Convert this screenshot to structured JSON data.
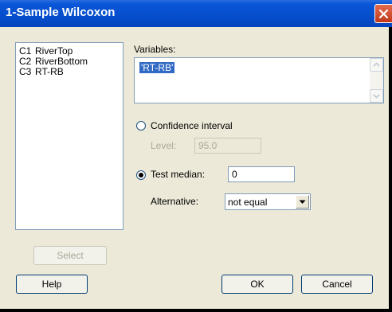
{
  "window": {
    "title": "1-Sample Wilcoxon"
  },
  "columns": [
    {
      "id": "C1",
      "name": "RiverTop"
    },
    {
      "id": "C2",
      "name": "RiverBottom"
    },
    {
      "id": "C3",
      "name": "RT-RB"
    }
  ],
  "variables": {
    "label": "Variables:",
    "value": "'RT-RB'"
  },
  "confidence": {
    "label": "Confidence interval",
    "selected": false,
    "level_label": "Level:",
    "level_value": "95.0"
  },
  "test": {
    "label": "Test median:",
    "selected": true,
    "median_value": "0",
    "alternative_label": "Alternative:",
    "alternative_value": "not equal"
  },
  "buttons": {
    "select": "Select",
    "help": "Help",
    "ok": "OK",
    "cancel": "Cancel"
  },
  "icons": {
    "close": "close-icon",
    "scroll_up": "arrow-up-icon",
    "scroll_down": "arrow-down-icon",
    "dropdown": "chevron-down-icon"
  },
  "colors": {
    "titlebar": "#0a56d8",
    "dialog_bg": "#ece9d8",
    "selection": "#316ac5",
    "close": "#d2442a"
  }
}
